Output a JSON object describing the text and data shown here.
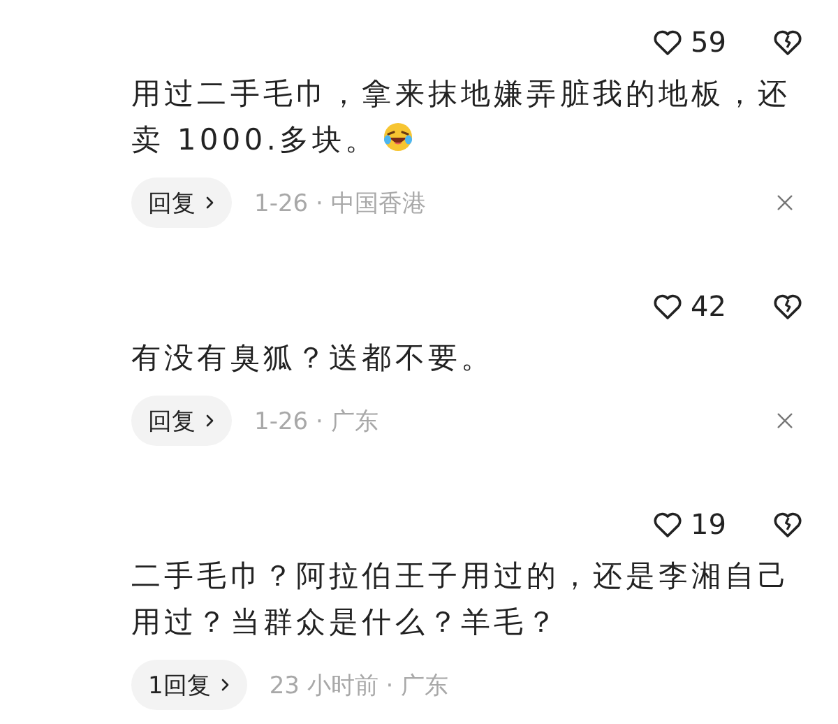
{
  "comments": [
    {
      "likes": "59",
      "text": "用过二手毛巾，拿来抹地嫌弄脏我的地板，还卖 1000.多块。",
      "has_emoji": true,
      "reply": "回复",
      "meta": "1-26 · 中国香港",
      "dismissible": true
    },
    {
      "likes": "42",
      "text": "有没有臭狐？送都不要。",
      "reply": "回复",
      "meta": "1-26 · 广东",
      "dismissible": true
    },
    {
      "likes": "19",
      "text": "二手毛巾？阿拉伯王子用过的，还是李湘自己用过？当群众是什么？羊毛？",
      "reply": "1回复",
      "meta": "23 小时前 · 广东",
      "dismissible": false
    }
  ]
}
